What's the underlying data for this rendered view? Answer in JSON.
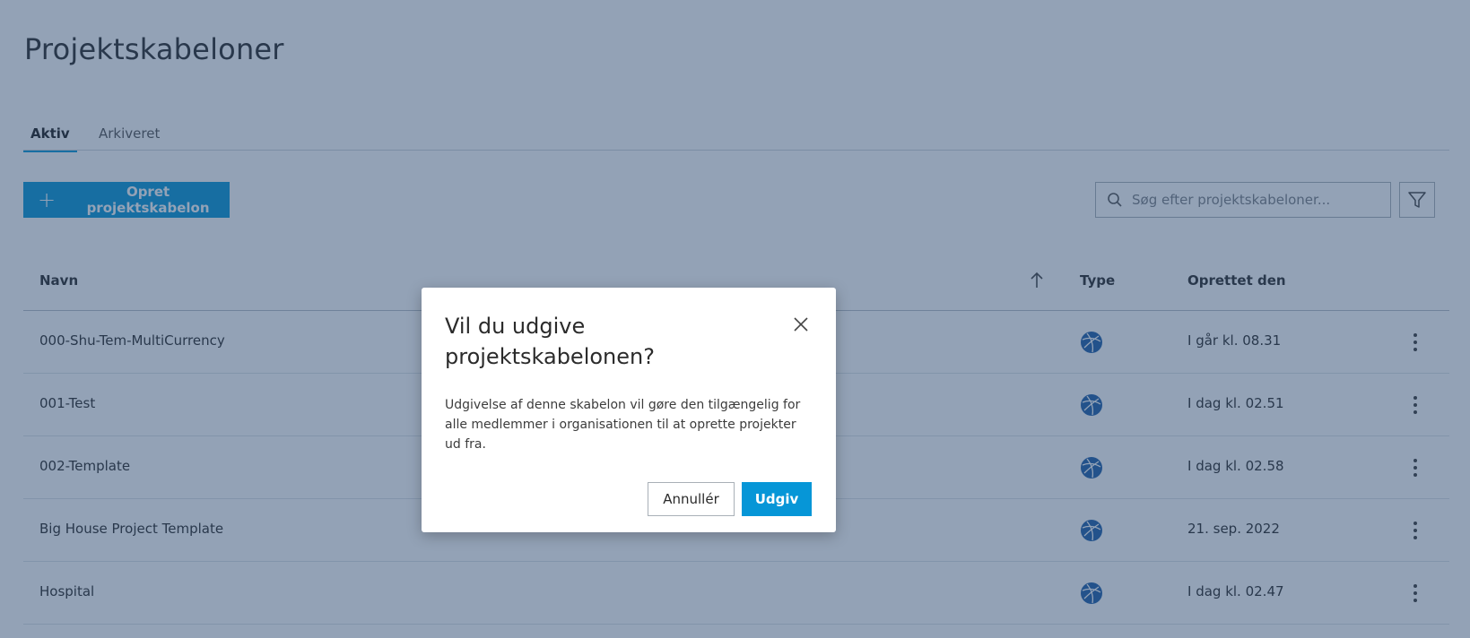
{
  "page": {
    "title": "Projektskabeloner"
  },
  "tabs": [
    {
      "label": "Aktiv",
      "active": true
    },
    {
      "label": "Arkiveret",
      "active": false
    }
  ],
  "toolbar": {
    "create_label": "Opret projektskabelon",
    "search_placeholder": "Søg efter projektskabeloner..."
  },
  "table": {
    "columns": {
      "name": "Navn",
      "type": "Type",
      "created": "Oprettet den"
    },
    "rows": [
      {
        "name": "000-Shu-Tem-MultiCurrency",
        "type_icon": "globe-icon",
        "created": "I går kl. 08.31"
      },
      {
        "name": "001-Test",
        "type_icon": "globe-icon",
        "created": "I dag kl. 02.51"
      },
      {
        "name": "002-Template",
        "type_icon": "globe-icon",
        "created": "I dag kl. 02.58"
      },
      {
        "name": "Big House Project Template",
        "type_icon": "globe-icon",
        "created": "21. sep. 2022"
      },
      {
        "name": "Hospital",
        "type_icon": "globe-icon",
        "created": "I dag kl. 02.47"
      }
    ]
  },
  "dialog": {
    "title": "Vil du udgive projektskabelonen?",
    "body": "Udgivelse af denne skabelon vil gøre den tilgængelig for alle medlemmer i organisationen til at oprette projekter ud fra.",
    "cancel_label": "Annullér",
    "confirm_label": "Udgiv"
  },
  "colors": {
    "accent": "#0696d7",
    "overlay": "#284670"
  }
}
